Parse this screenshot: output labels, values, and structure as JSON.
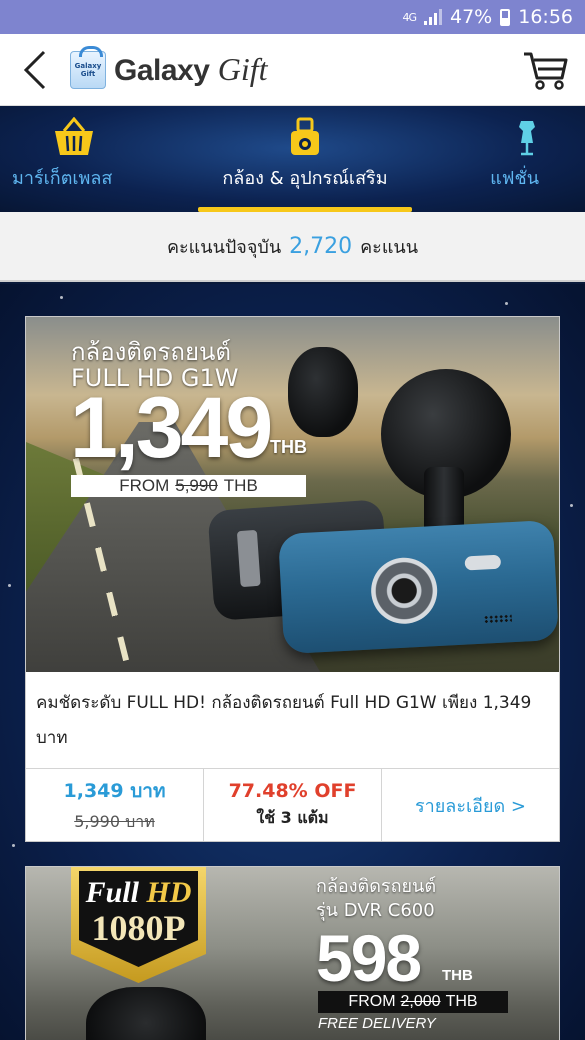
{
  "status_bar": {
    "network": "4G",
    "battery": "47%",
    "time": "16:56"
  },
  "header": {
    "logo_box_text": "Galaxy Gift",
    "logo_bold": "Galaxy",
    "logo_italic": "Gift"
  },
  "tabs": [
    {
      "label": "มาร์เก็ตเพลส",
      "icon": "basket-icon"
    },
    {
      "label": "กล้อง & อุปกรณ์เสริม",
      "icon": "camera-icon",
      "active": true
    },
    {
      "label": "แฟชั่น",
      "icon": "dress-form-icon"
    }
  ],
  "points_bar": {
    "prefix": "คะแนนปัจจุบัน",
    "points": "2,720",
    "suffix": "คะแนน"
  },
  "products": [
    {
      "banner": {
        "title_line1": "กล้องติดรถยนต์",
        "title_line2": "FULL HD G1W",
        "price": "1,349",
        "currency": "THB",
        "from_label": "FROM",
        "from_price": "5,990",
        "from_currency": "THB"
      },
      "description": "คมชัดระดับ FULL HD! กล้องติดรถยนต์ Full HD G1W เพียง 1,349 บาท",
      "price_now": "1,349 บาท",
      "price_old": "5,990 บาท",
      "discount": "77.48% OFF",
      "points_use": "ใช้ 3 แต้ม",
      "detail_link": "รายละเอียด >"
    },
    {
      "banner": {
        "badge_full": "Full",
        "badge_hd": "HD",
        "badge_res": "1080P",
        "title_line1": "กล้องติดรถยนต์",
        "title_line2": "รุ่น DVR C600",
        "price": "598",
        "currency": "THB",
        "from_label": "FROM",
        "from_price": "2,000",
        "from_currency": "THB",
        "free_delivery": "FREE DELIVERY"
      }
    }
  ],
  "colors": {
    "status_bar": "#7e84cf",
    "accent_blue": "#2a9bd7",
    "discount_red": "#e0402c",
    "active_tab_underline": "#f7c81a"
  }
}
